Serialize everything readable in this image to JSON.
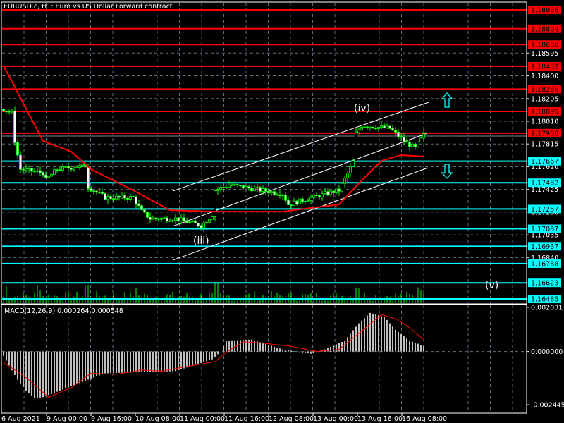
{
  "title": "EURUSD.c, H1:  Euro vs US Dollar Forward contract",
  "colors": {
    "background": "#000000",
    "grid": "#5f6e7f",
    "candle": "#00ff00",
    "ma": "#ff0000",
    "resistance": "#ff0000",
    "support": "#00ffff",
    "histogram": "#c0c0c0",
    "signal": "#ff0000",
    "channel": "#ffffff"
  },
  "price_axis": {
    "range": [
      1.16445,
      1.19
    ],
    "grid_labels": [
      "1.18595",
      "1.18400",
      "1.18205",
      "1.18010",
      "1.17815",
      "1.17620",
      "1.17425",
      "1.17230",
      "1.17035",
      "1.16840"
    ],
    "resistance_levels": [
      "1.18966",
      "1.18804",
      "1.18668",
      "1.18482",
      "1.18286",
      "1.18095",
      "1.17908"
    ],
    "support_levels": [
      "1.17667",
      "1.17482",
      "1.17257",
      "1.17087",
      "1.16937",
      "1.16788",
      "1.16623",
      "1.16485"
    ]
  },
  "time_axis": {
    "labels": [
      "6 Aug 2021",
      "9 Aug 00:00",
      "9 Aug 16:00",
      "10 Aug 08:00",
      "11 Aug 00:00",
      "11 Aug 16:00",
      "12 Aug 08:00",
      "13 Aug 00:00",
      "13 Aug 16:00",
      "16 Aug 08:00"
    ]
  },
  "wave_labels": {
    "iii": "(iii)",
    "iv": "(iv)",
    "v": "(v)"
  },
  "icons": {
    "up": "up-arrow-icon",
    "down": "down-arrow-icon"
  },
  "chart_data": [
    {
      "type": "candlestick",
      "symbol": "EURUSD.c",
      "timeframe": "H1",
      "bars": 150,
      "close_keypoints": [
        [
          0,
          1.18113
        ],
        [
          3,
          1.18082
        ],
        [
          4,
          1.17841
        ],
        [
          6,
          1.17598
        ],
        [
          14,
          1.17568
        ],
        [
          15,
          1.17508
        ],
        [
          19,
          1.17598
        ],
        [
          29,
          1.17629
        ],
        [
          30,
          1.17447
        ],
        [
          36,
          1.17356
        ],
        [
          46,
          1.17356
        ],
        [
          49,
          1.17235
        ],
        [
          52,
          1.17175
        ],
        [
          61,
          1.17175
        ],
        [
          70,
          1.17114
        ],
        [
          74,
          1.17205
        ],
        [
          75,
          1.17417
        ],
        [
          80,
          1.17465
        ],
        [
          99,
          1.17387
        ],
        [
          101,
          1.17296
        ],
        [
          114,
          1.17387
        ],
        [
          119,
          1.17417
        ],
        [
          124,
          1.17659
        ],
        [
          125,
          1.17901
        ],
        [
          127,
          1.17974
        ],
        [
          137,
          1.17949
        ],
        [
          142,
          1.1784
        ],
        [
          146,
          1.1778
        ],
        [
          149,
          1.17889
        ]
      ],
      "ma_keypoints": [
        [
          0,
          1.18488
        ],
        [
          14,
          1.17841
        ],
        [
          24,
          1.1775
        ],
        [
          31,
          1.17598
        ],
        [
          46,
          1.17417
        ],
        [
          59,
          1.17247
        ],
        [
          74,
          1.17235
        ],
        [
          99,
          1.17235
        ],
        [
          119,
          1.17296
        ],
        [
          126,
          1.17477
        ],
        [
          134,
          1.17671
        ],
        [
          141,
          1.1772
        ],
        [
          149,
          1.17708
        ]
      ]
    },
    {
      "type": "histogram+line",
      "title": "MACD(12,26,9) 0.000264 0.000548",
      "ylim": [
        -0.002445,
        0.002031
      ],
      "tick_labels": [
        "0.002031",
        "0.000000",
        "-0.002445"
      ],
      "macd_keypoints": [
        [
          0,
          -0.0002
        ],
        [
          5,
          -0.0013
        ],
        [
          8,
          -0.0018
        ],
        [
          11,
          -0.00215
        ],
        [
          14,
          -0.0021
        ],
        [
          36,
          -0.001
        ],
        [
          61,
          -0.0009
        ],
        [
          74,
          -0.00036
        ],
        [
          77,
          0.0
        ],
        [
          79,
          0.0005
        ],
        [
          88,
          0.00055
        ],
        [
          99,
          0.0001
        ],
        [
          109,
          -0.0001
        ],
        [
          114,
          0.0001
        ],
        [
          121,
          0.0005
        ],
        [
          126,
          0.0013
        ],
        [
          130,
          0.00178
        ],
        [
          135,
          0.0016
        ],
        [
          139,
          0.001
        ],
        [
          144,
          0.0005
        ],
        [
          149,
          0.000264
        ]
      ],
      "signal_keypoints": [
        [
          0,
          -0.0005
        ],
        [
          8,
          -0.0012
        ],
        [
          16,
          -0.0021
        ],
        [
          24,
          -0.00166
        ],
        [
          31,
          -0.001
        ],
        [
          40,
          -0.00105
        ],
        [
          49,
          -0.00085
        ],
        [
          56,
          -0.0009
        ],
        [
          69,
          -0.0006
        ],
        [
          75,
          -0.00047
        ],
        [
          79,
          -3e-05
        ],
        [
          85,
          0.00045
        ],
        [
          91,
          0.0004
        ],
        [
          102,
          0.00024
        ],
        [
          111,
          0.0
        ],
        [
          119,
          0.0001
        ],
        [
          126,
          0.00083
        ],
        [
          134,
          0.0017
        ],
        [
          139,
          0.0015
        ],
        [
          143,
          0.0012
        ],
        [
          149,
          0.000548
        ]
      ]
    }
  ]
}
